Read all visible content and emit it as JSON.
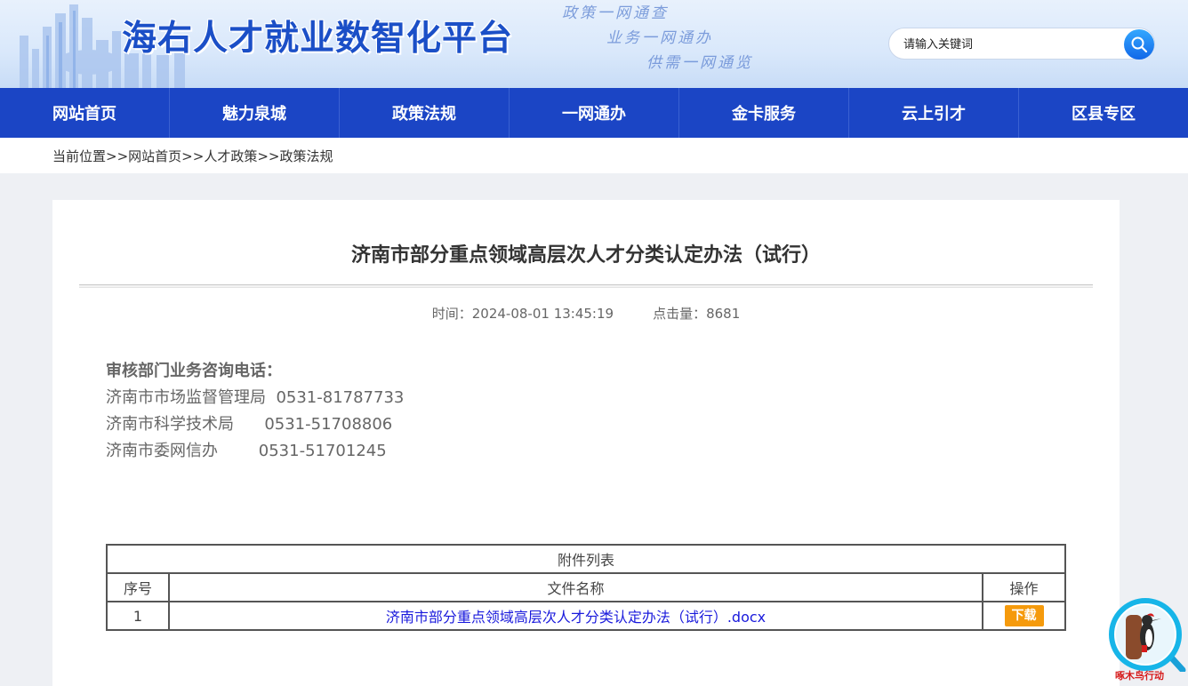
{
  "header": {
    "site_title": "海右人才就业数智化平台",
    "slogans": [
      "政策一网通查",
      "业务一网通办",
      "供需一网通览"
    ],
    "search": {
      "placeholder": "请输入关键词"
    }
  },
  "nav": {
    "items": [
      "网站首页",
      "魅力泉城",
      "政策法规",
      "一网通办",
      "金卡服务",
      "云上引才",
      "区县专区"
    ]
  },
  "breadcrumb": {
    "label": "当前位置",
    "path": [
      "网站首页",
      "人才政策",
      "政策法规"
    ],
    "separator": ">>"
  },
  "article": {
    "title": "济南市部分重点领域高层次人才分类认定办法（试行）",
    "time_label": "时间：",
    "time_value": "2024-08-01 13:45:19",
    "clicks_label": "点击量：",
    "clicks_value": "8681",
    "contact_heading": "审核部门业务咨询电话：",
    "contacts": [
      "济南市市场监督管理局  0531-81787733",
      "济南市科学技术局      0531-51708806",
      "济南市委网信办        0531-51701245"
    ]
  },
  "attachments": {
    "caption": "附件列表",
    "headers": [
      "序号",
      "文件名称",
      "操作"
    ],
    "rows": [
      {
        "index": "1",
        "name": "济南市部分重点领域高层次人才分类认定办法（试行）.docx",
        "action": "下载"
      }
    ]
  },
  "float_widget": {
    "label": "啄木鸟行动"
  },
  "colors": {
    "nav_bg": "#1b45c5",
    "accent_blue": "#1b4fc7",
    "download_orange": "#f59a0c",
    "link_blue": "#1a1adc"
  }
}
